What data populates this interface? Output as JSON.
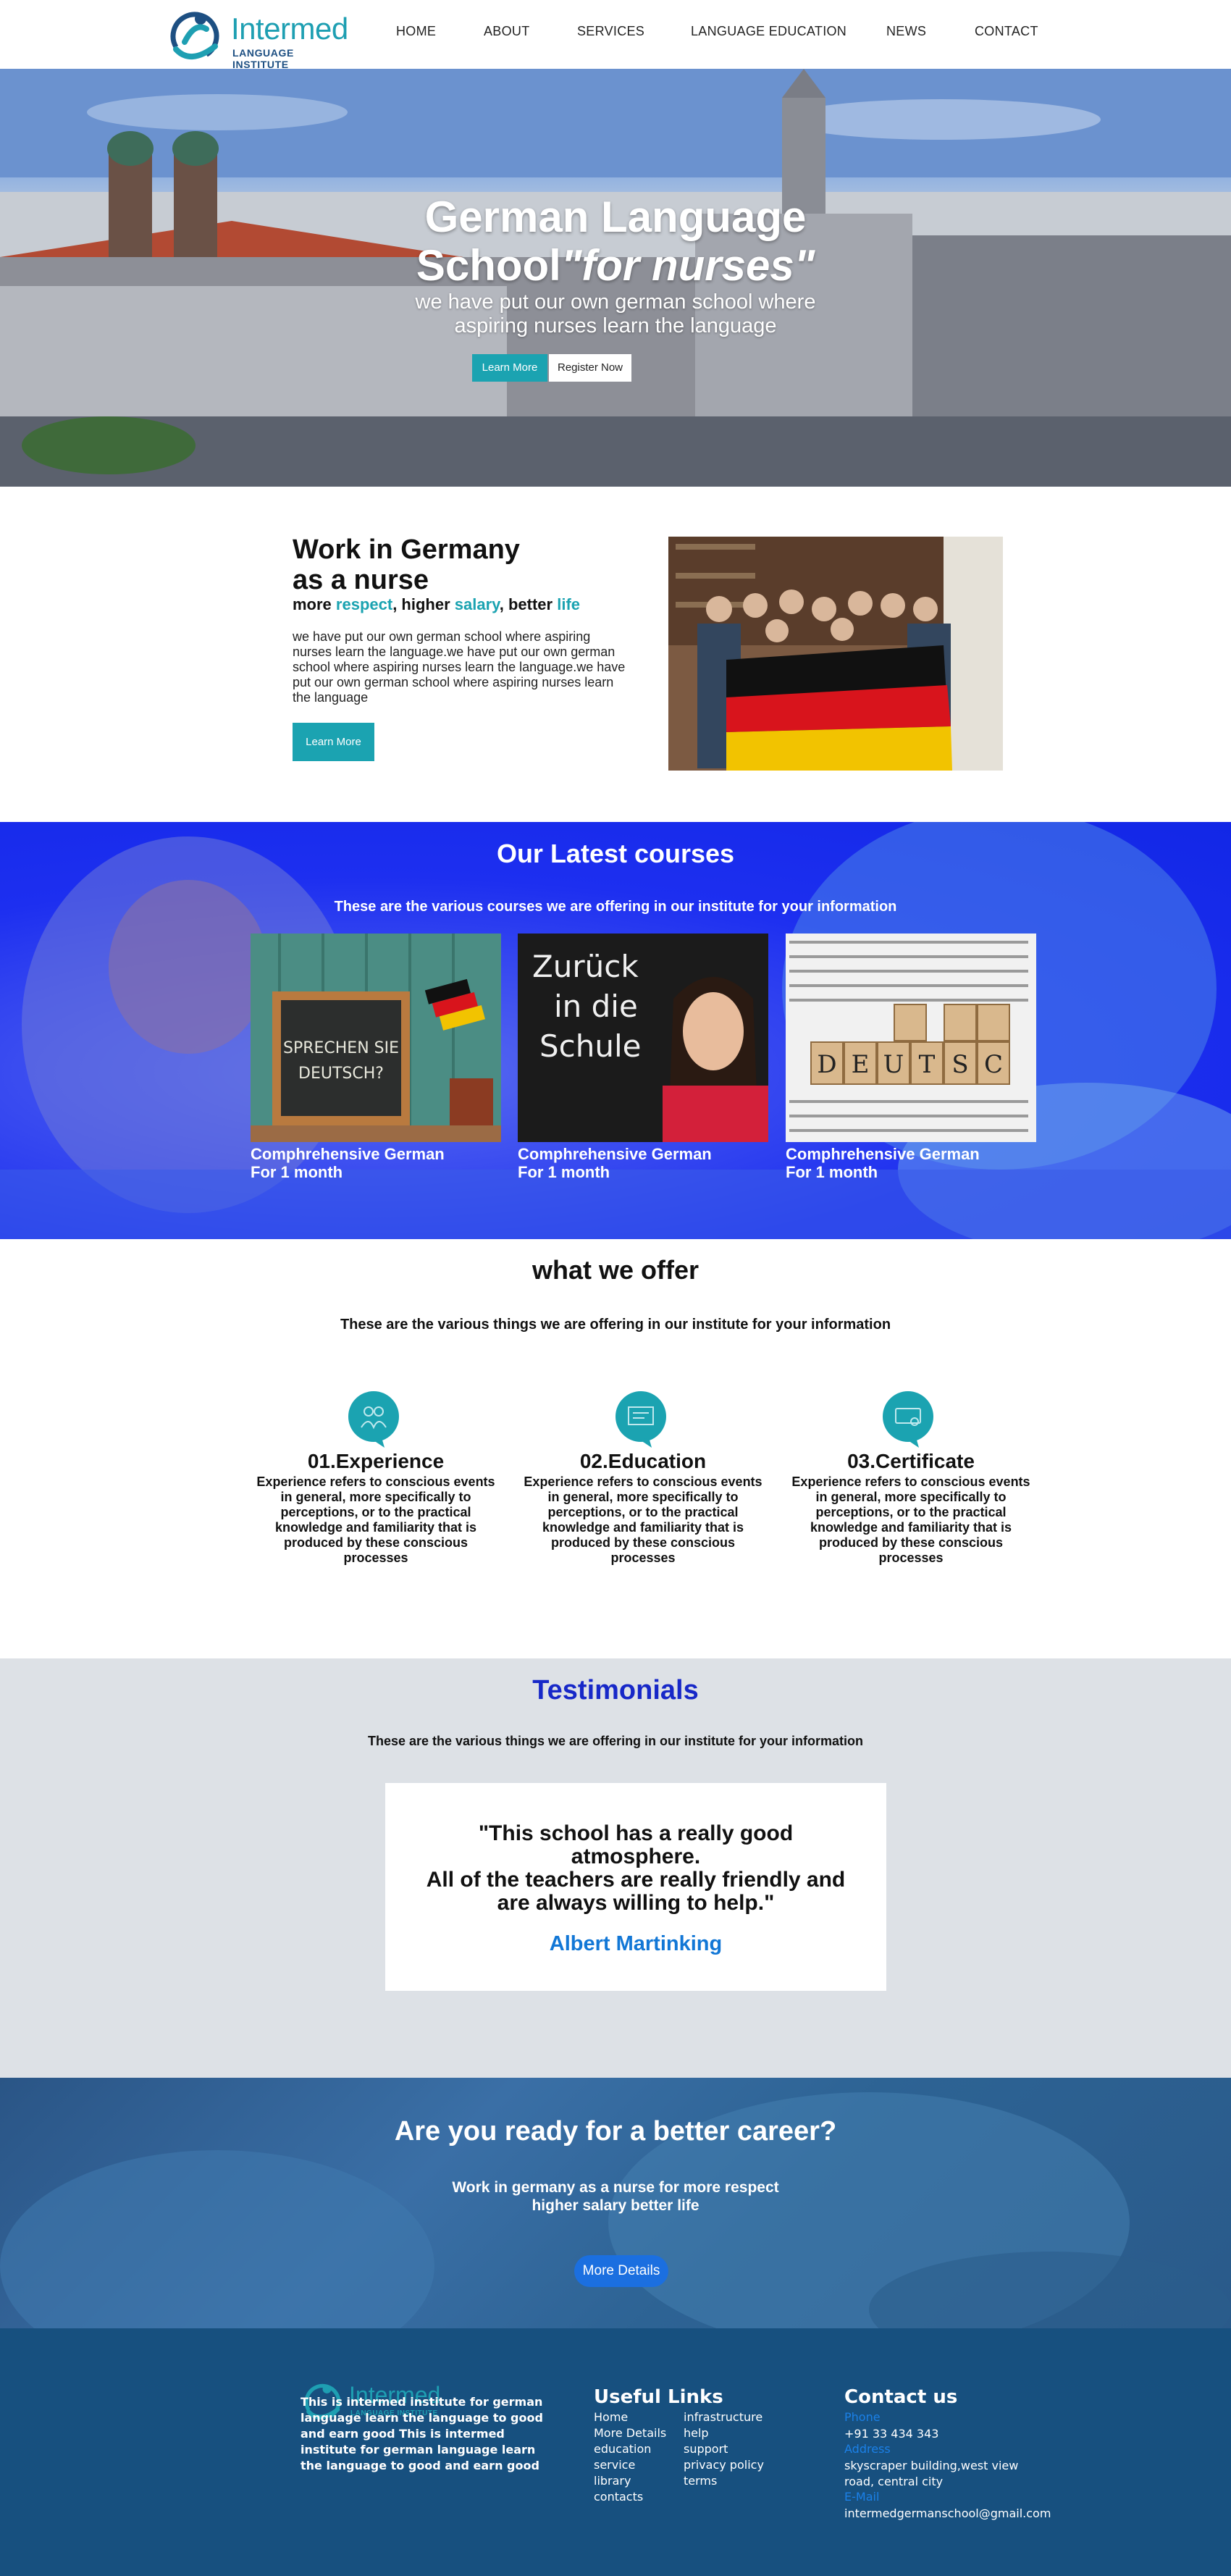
{
  "brand": {
    "name": "Intermed",
    "tagline": "LANGUAGE INSTITUTE"
  },
  "nav": [
    "HOME",
    "ABOUT",
    "SERVICES",
    "LANGUAGE EDUCATION",
    "NEWS",
    "CONTACT"
  ],
  "hero": {
    "title_line1": "German Language",
    "title_line2_plain": "School",
    "title_line2_italic": "\"for nurses\"",
    "subtitle_line1": "we have put our own german school where",
    "subtitle_line2": "aspiring nurses learn the language",
    "learn_more": "Learn More",
    "register": "Register Now"
  },
  "work": {
    "title_line1": "Work in Germany",
    "title_line2": "as a nurse",
    "tag_more": "more ",
    "tag_respect": "respect",
    "tag_higher": ", higher ",
    "tag_salary": "salary",
    "tag_better": ", better ",
    "tag_life": "life",
    "body": "we have put our own german school where aspiring nurses learn the language.we have put our own german school where aspiring nurses learn the language.we have put our own german school where aspiring nurses learn the language",
    "button": "Learn More"
  },
  "courses": {
    "title": "Our Latest courses",
    "subtitle": "These are the various courses we are offering in our institute for your information",
    "items": [
      {
        "line1": "Comphrehensive German",
        "line2": "For 1 month",
        "image_text": "SPRECHEN SIE DEUTSCH?"
      },
      {
        "line1": "Comphrehensive German",
        "line2": "For 1 month",
        "image_text": "Zurück in die Schule"
      },
      {
        "line1": "Comphrehensive German",
        "line2": "For 1 month",
        "image_text": "DEUTSCH"
      }
    ]
  },
  "offer": {
    "title": "what we offer",
    "subtitle": "These are the various things we are offering in our institute for your information",
    "items": [
      {
        "title": "01.Experience",
        "text": "Experience refers to conscious events in general, more specifically to perceptions, or to the practical knowledge and familiarity that is produced by these conscious processes",
        "icon": "people-icon"
      },
      {
        "title": "02.Education",
        "text": "Experience refers to conscious events in general, more specifically to perceptions, or to the practical knowledge and familiarity that is produced by these conscious processes",
        "icon": "board-icon"
      },
      {
        "title": "03.Certificate",
        "text": "Experience refers to conscious events in general, more specifically to perceptions, or to the practical knowledge and familiarity that is produced by these conscious processes",
        "icon": "certificate-icon"
      }
    ]
  },
  "testimonials": {
    "title": "Testimonials",
    "subtitle": "These are the various things we are offering in our institute for your information",
    "quote_line1": "\"This school has a really good atmosphere.",
    "quote_line2": "All of the teachers are really friendly and",
    "quote_line3": "are always willing to help.\"",
    "author": "Albert Martinking"
  },
  "career": {
    "title": "Are you ready for a better career?",
    "sub_line1": "Work in germany as a nurse for more respect",
    "sub_line2": "higher salary better life",
    "button": "More Details"
  },
  "footer": {
    "about": "This is intermed institute for german language learn the language to good and earn good This is intermed institute for german language learn the language to good and earn good",
    "links_title": "Useful Links",
    "links_col1": [
      "Home",
      "More Details",
      "education",
      "service",
      "library",
      "contacts"
    ],
    "links_col2": [
      "infrastructure",
      "help",
      "support",
      "privacy policy",
      "terms"
    ],
    "contact_title": "Contact us",
    "phone_label": "Phone",
    "phone": "+91 33 434 343",
    "address_label": "Address",
    "address_line1": "skyscraper building,west view",
    "address_line2": "road, central city",
    "email_label": "E-Mail",
    "email": "intermedgermanschool@gmail.com"
  },
  "colors": {
    "teal": "#1ba3b1",
    "navy": "#17507f",
    "blue": "#1728c8",
    "link_blue": "#1b80e8"
  }
}
